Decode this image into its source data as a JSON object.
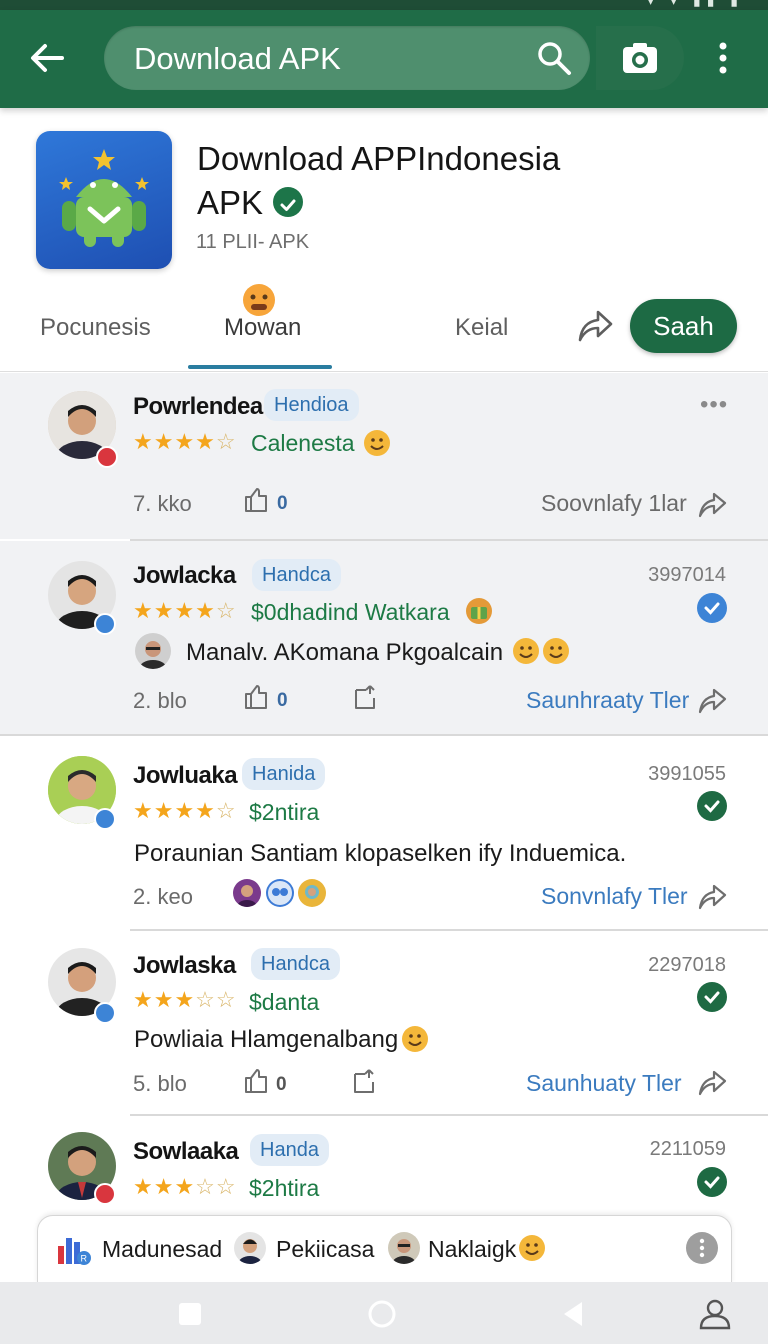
{
  "toolbar": {
    "search_text": "Download APK",
    "back_icon": "arrow-left-icon",
    "search_icon": "search-icon",
    "camera_icon": "camera-icon",
    "menu_icon": "more-vertical-icon",
    "color": "#1f6c47"
  },
  "app": {
    "title_line1": "Download APPIndonesia",
    "title_line2": "APK",
    "subtitle": "11 PLII- APK"
  },
  "tabs": {
    "items": [
      {
        "label": "Pocunesis"
      },
      {
        "label": "Mowan"
      },
      {
        "label": "Keial"
      }
    ],
    "active_index": 1,
    "share_icon": "share-icon",
    "save_label": "Saah"
  },
  "reviews": [
    {
      "name": "Powrlendea",
      "tag": "Hendioa",
      "rating": 4.5,
      "rating_text": "Calenesta",
      "meta": "7. kko",
      "likes": "0",
      "link": "Soovnlafy 1lar"
    },
    {
      "name": "Jowlacka",
      "tag": "Handca",
      "date": "3997014",
      "rating": 4.5,
      "rating_text": "$0dhadind Watkara",
      "body_author": "Manalv. AKomana Pkgoalcain",
      "meta": "2. blo",
      "likes": "0",
      "link": "Saunhraaty Tler"
    },
    {
      "name": "Jowluaka",
      "tag": "Hanida",
      "date": "3991055",
      "rating": 4.5,
      "rating_text": "$2ntira",
      "body": "Poraunian Santiam klopaselken ify Induemica.",
      "meta": "2. keo",
      "link": "Sonvnlafy Tler"
    },
    {
      "name": "Jowlaska",
      "tag": "Handca",
      "date": "2297018",
      "rating": 3.5,
      "rating_text": "$danta",
      "body": "Powliaia Hlamgenalbang",
      "meta": "5. blo",
      "likes": "0",
      "link": "Saunhuaty Tler"
    },
    {
      "name": "Sowlaaka",
      "tag": "Handa",
      "date": "2211059",
      "rating": 3.5,
      "rating_text": "$2htira"
    }
  ],
  "chipbar": {
    "items": [
      "Madunesad",
      "Pekiicasa",
      "Naklaigk"
    ]
  },
  "colors": {
    "accent": "#1f6c47",
    "link": "#3b7bbf",
    "star": "#f4a51c",
    "rating_text": "#1d7a45"
  }
}
